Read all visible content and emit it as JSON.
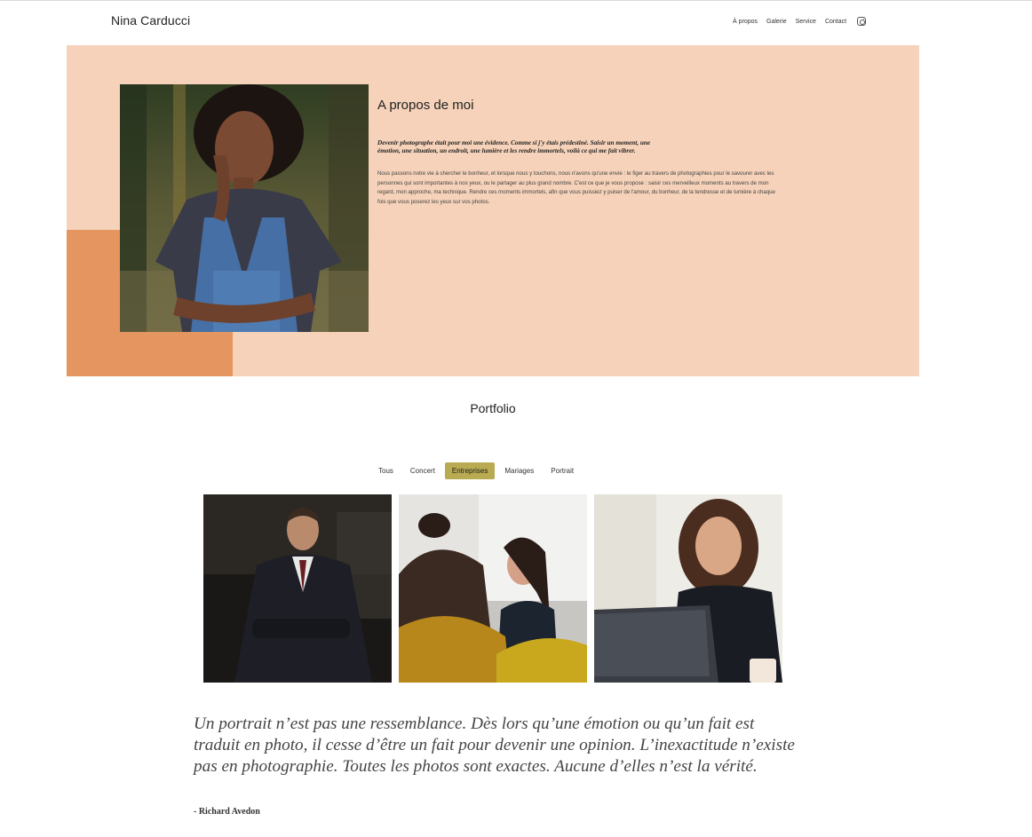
{
  "header": {
    "brand": "Nina Carducci",
    "nav": [
      "À propos",
      "Galerie",
      "Service",
      "Contact"
    ],
    "social_icon": "instagram-icon"
  },
  "about": {
    "title": "A propos de moi",
    "lead": "Devenir photographe était pour moi une évidence. Comme si j'y étais prédestiné. Saisir un moment, une émotion, une situation, un endroit, une lumière et les rendre immortels, voilà ce qui me fait vibrer.",
    "body": "Nous passons notre vie à chercher le bonheur, et lorsque nous y touchons, nous n'avons qu'une envie : le figer au travers de photographies pour le savourer avec les personnes qui sont importantes à nos yeux, ou le partager au plus grand nombre. C'est ce que je vous propose : saisir ces merveilleux moments au travers de mon regard, mon approche, ma technique. Rendre ces moments immortels, afin que vous puissiez y puiser de l'amour, du bonheur, de la tendresse et de lumière à chaque fois que vous poserez les yeux sur vos photos.",
    "colors": {
      "background": "#f5d2b9",
      "accent": "#e59660"
    }
  },
  "portfolio": {
    "title": "Portfolio",
    "filters": [
      "Tous",
      "Concert",
      "Entreprises",
      "Mariages",
      "Portrait"
    ],
    "active_filter": "Entreprises",
    "active_color": "#b8ab52"
  },
  "quote": {
    "text": "Un portrait n’est pas une ressemblance. Dès lors qu’une émotion ou qu’un fait est traduit en photo, il cesse d’être un fait pour devenir une opinion. L’inexactitude n’existe pas en photographie. Toutes les photos sont exactes. Aucune d’elles n’est la vérité.",
    "author": "- Richard Avedon"
  }
}
